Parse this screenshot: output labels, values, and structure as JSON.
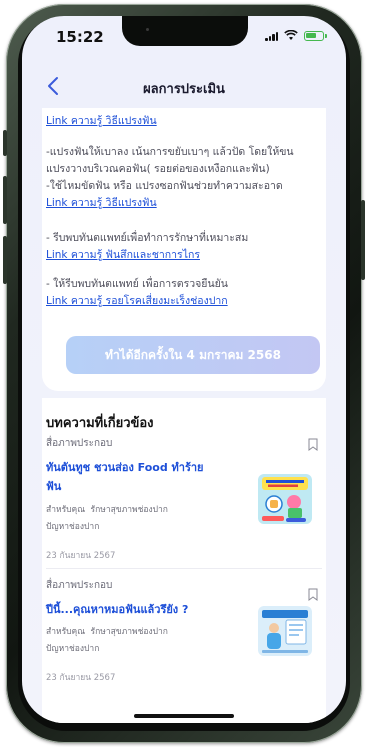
{
  "status": {
    "time": "15:22"
  },
  "header": {
    "title": "ผลการประเมิน"
  },
  "recommend": {
    "link_1": "Link ความรู้ วิธีแปรงฟัน",
    "para_2_l1": "-แปรงฟันให้เบาลง เน้นการขยับเบาๆ แล้วปัด โดยให้ขน",
    "para_2_l2": "แปรงวางบริเวณคอฟัน( รอยต่อของเหงือกและฟัน)",
    "para_2_l3": "-ใช้ไหมขัดฟัน หรือ แปรงซอกฟันช่วยทำความสะอาด",
    "link_2": "Link ความรู้ วิธีแปรงฟัน",
    "para_3": "- รีบพบทันตแพทย์เพื่อทำการรักษาที่เหมาะสม",
    "link_3": "Link ความรู้ ฟันสึกและชาการไกร",
    "para_4": "- ให้รีบพบทันตแพทย์ เพื่อการตรวจยืนยัน",
    "link_4": "Link ความรู้ รอยโรคเสี่ยงมะเร็งช่องปาก"
  },
  "cta": {
    "label": "ทำได้อีกครั้งใน 4 มกราคม 2568"
  },
  "articles": {
    "section_title": "บทความที่เกี่ยวข้อง",
    "items": [
      {
        "type": "สื่อภาพประกอบ",
        "title_l1": "ทันตันทูช ชวนส่อง Food ทำร้าย",
        "title_l2": "ฟัน",
        "for": "สำหรับคุณ",
        "tag": "รักษาสุขภาพช่องปาก",
        "topic": "ปัญหาช่องปาก",
        "date": "23 กันยายน 2567",
        "icon": "bookmark-icon"
      },
      {
        "type": "สื่อภาพประกอบ",
        "title_l1": "ปีนี้...คุณหาหมอฟันแล้วรึยัง ?",
        "for": "สำหรับคุณ",
        "tag": "รักษาสุขภาพช่องปาก",
        "topic": "ปัญหาช่องปาก",
        "date": "23 กันยายน 2567",
        "icon": "bookmark-icon"
      }
    ]
  },
  "colors": {
    "link": "#1d4fd8",
    "accent_start": "#b6d0f7",
    "accent_end": "#c3c7f3",
    "battery": "#45b84f"
  }
}
